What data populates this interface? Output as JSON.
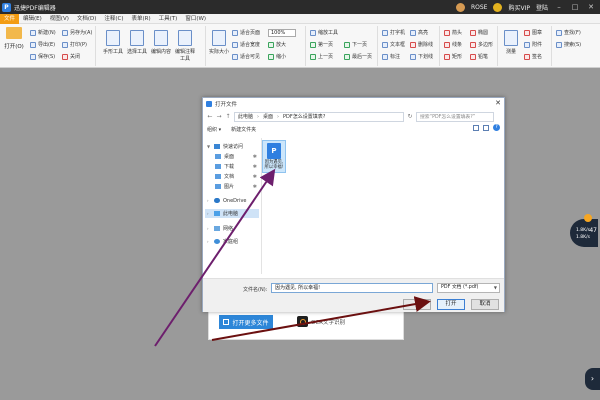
{
  "app": {
    "title": "迅捷PDF编辑器",
    "icon": "pdf-app-icon"
  },
  "titlebar": {
    "user_name": "ROSE",
    "vip_label": "购买VIP",
    "login_label": "登陆"
  },
  "menu": {
    "items": [
      "文件",
      "编辑(E)",
      "视图(V)",
      "文档(D)",
      "注释(C)",
      "表单(R)",
      "工具(T)",
      "窗口(W)"
    ],
    "active_index": 0,
    "right_items": [
      "窗口(W)",
      "查找(F)",
      "搜索(S)"
    ]
  },
  "ribbon": {
    "open_label": "打开(O)",
    "file_group": [
      "新建(N)",
      "导出(E)",
      "保存(S)",
      "另存为(A)",
      "打印(P)",
      "关闭"
    ],
    "tools": [
      "手形工具",
      "选择工具",
      "编辑内容",
      "编辑表单",
      "编辑注释工具",
      "添加文本",
      "图片"
    ],
    "view": [
      "实际大小",
      "适合页面",
      "适合宽度",
      "适合可见"
    ],
    "zoom_value": "100%",
    "page_nav": [
      "缩放工具",
      "放大",
      "缩小",
      "第一页",
      "上一页",
      "下一页",
      "最后一页"
    ],
    "annot_tools": [
      "打字机",
      "文本框",
      "便签",
      "标注",
      "高亮",
      "下划线",
      "删除线",
      "添加注释"
    ],
    "shapes": [
      "线条",
      "矩形",
      "椭圆",
      "多边形",
      "箭头",
      "云形",
      "铅笔"
    ],
    "extra": [
      "测量",
      "图章",
      "附件",
      "签名"
    ],
    "right_tools": [
      "查找(F)",
      "搜索(S)"
    ]
  },
  "start_panel": {
    "open_more_label": "打开更多文件",
    "ocr_label": "OCR文字识别"
  },
  "dialog": {
    "title": "打开文件",
    "breadcrumb": [
      "此电脑",
      "桌面",
      "PDF怎么设置填表?"
    ],
    "search_placeholder": "搜索“PDF怎么设置填表?”",
    "organize_label": "组织 ▾",
    "new_folder_label": "新建文件夹",
    "nav": [
      {
        "label": "快速访问",
        "icon": "star-icon",
        "level": 0
      },
      {
        "label": "桌面",
        "icon": "desktop-icon",
        "level": 1,
        "pinned": true
      },
      {
        "label": "下载",
        "icon": "download-icon",
        "level": 1,
        "pinned": true
      },
      {
        "label": "文档",
        "icon": "document-icon",
        "level": 1,
        "pinned": true
      },
      {
        "label": "图片",
        "icon": "picture-icon",
        "level": 1,
        "pinned": true
      },
      {
        "label": "OneDrive",
        "icon": "cloud-icon",
        "level": 0
      },
      {
        "label": "此电脑",
        "icon": "computer-icon",
        "level": 0,
        "selected": true
      },
      {
        "label": "网络",
        "icon": "network-icon",
        "level": 0
      },
      {
        "label": "家庭组",
        "icon": "homegroup-icon",
        "level": 0
      }
    ],
    "file": {
      "name_line1": "因为遇见,",
      "name_line2": "所以幸福!",
      "icon": "pdf-file-icon"
    },
    "filename_label": "文件名(N):",
    "filename_value": "因为遇见, 所以幸福!",
    "filetype_value": "PDF 文档 (*.pdf)",
    "open_label": "打开",
    "cancel_label": "取消"
  },
  "side_widget": {
    "row1": "1.8K/s",
    "row2": "1.8K/s",
    "number": "47"
  },
  "colors": {
    "accent": "#f39c12",
    "annotation_arrow": "#6d1f6d",
    "dark_arrow": "#6b1010"
  }
}
